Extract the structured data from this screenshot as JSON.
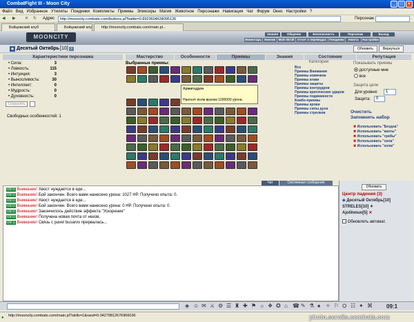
{
  "window_title": "CombatFight III - Moon City",
  "menu": [
    "Файл",
    "Вид",
    "Избранное",
    "Утилиты",
    "Поединки",
    "Комплекты",
    "Приемы",
    "Эликсиры",
    "Магия",
    "Животное",
    "Персонажи",
    "Навигация",
    "Чат",
    "Форум",
    "Окно",
    "Настройки",
    "?"
  ],
  "address": {
    "label": "Адрес",
    "url": "http://mooncity.combats.com/buttons.pl?battle=0.8923604634095126",
    "right_label": "Персонаж"
  },
  "browser_tabs": [
    "Бойцовский клуб",
    "Бойцовский клуб...",
    "http://mooncity.combats.com/main.pl..."
  ],
  "logo": "MOONCITY",
  "top_nav_row1": [
    "Знания",
    "Общение",
    "Безопасность",
    "Персонаж",
    "Выход"
  ],
  "top_nav_row2": [
    "Инвентарь",
    "Умения",
    "Мой Skroll",
    "Отчет о переводах",
    "Поединки",
    "Анкета",
    "Настройки"
  ],
  "character": {
    "name": "Десятый Октябрь",
    "level": "[10]",
    "info_icon": "i"
  },
  "buttons": {
    "refresh": "Обновить",
    "back": "Вернуться",
    "sidebar_refresh": "Обновить",
    "save": "Сохранить"
  },
  "section_tabs": [
    "Характеристики персонажа",
    "Мастерство",
    "Особенности",
    "Приемы",
    "Знания",
    "Состояние",
    "Репутация"
  ],
  "stats": [
    {
      "label": "• Сила:",
      "value": "3"
    },
    {
      "label": "• Ловкость:",
      "value": "115"
    },
    {
      "label": "• Интуиция:",
      "value": "3"
    },
    {
      "label": "• Выносливость:",
      "value": "30"
    },
    {
      "label": "• Интеллект:",
      "value": "0"
    },
    {
      "label": "• Мудрость:",
      "value": "0"
    },
    {
      "label": "• Духовность:",
      "value": "0"
    }
  ],
  "free_features": "Свободных особенностей: 1",
  "selected_skills_title": "Выбранные приемы:",
  "tooltip": {
    "title": "Армагеддон",
    "text": "Наносит всем врагам 1000000 урона."
  },
  "categories_title": "Категории",
  "categories": [
    "Все",
    "Приемы Внимания",
    "Приемы новичков",
    "Приемы атаки",
    "Приемы защиты",
    "Приемы контрудров",
    "Приемы критических ударов",
    "Приемы подвижности",
    "Комбо-приемы",
    "Приемы крови",
    "Приемы силы духа",
    "Приемы стрелков"
  ],
  "show_title": "Показывать приемы",
  "show_options": [
    {
      "label": "доступные мне",
      "checked": true
    },
    {
      "label": "все",
      "checked": false
    }
  ],
  "protection_title": "Защита цели",
  "for_level_label": "Для уровня:",
  "for_level_value": "1",
  "protection_label": "Защита:",
  "protection_value": "0",
  "clear_link": "Очистить",
  "remember_link": "Запомнить набор",
  "use_items": [
    "Использовать \"Бездна\"",
    "Использовать \"каоты\"",
    "Использовать \"грибы\"",
    "Использовать \"сила\"",
    "Использовать \"холм\""
  ],
  "chat_tabs": [
    "Чат",
    "Системные сообщения"
  ],
  "chat_lines": [
    {
      "time": "09:0",
      "warn": "Внимание!",
      "text": "Хвост нуждается в еде..."
    },
    {
      "time": "09:0",
      "warn": "Внимание!",
      "text": "Бой закончен. Всего вами нанесено урона: 1027 HP. Получено опыта: 0."
    },
    {
      "time": "09:0",
      "warn": "Внимание!",
      "text": "Хвост нуждается в еде..."
    },
    {
      "time": "09:0",
      "warn": "Внимание!",
      "text": "Бой закончен. Всего вами нанесено урона: 0 HP. Получено опыта: 0."
    },
    {
      "time": "09:0",
      "warn": "Внимание!",
      "text": "Закончилось действие эффекта \"Ускорение\""
    },
    {
      "time": "09:0",
      "warn": "Внимание!",
      "text": "Получена новая почта от неизв."
    },
    {
      "time": "09:1",
      "warn": "Внимание!",
      "text": "Связь с pavel busarov прервалась..."
    }
  ],
  "location_title": "Центр падения (3)",
  "players": [
    "Десятый Октябрь[10]",
    "STRELES[10]",
    "Ajolihmun[5]"
  ],
  "auto_refresh_label": "Обновлять автомат.",
  "clock": "09:1",
  "status_url": "http://mooncity.combats.com/main.pl?skills=1&rand=0.04279812676966036",
  "watermark": "photo.scrolls.combats.com"
}
